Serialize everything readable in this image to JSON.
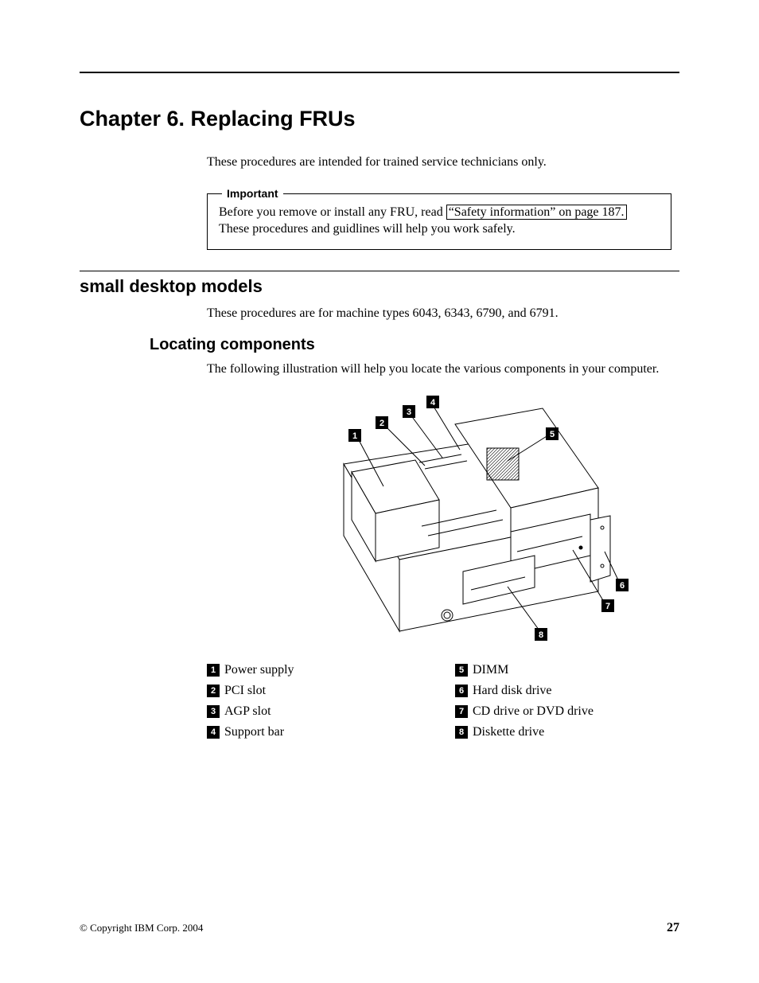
{
  "chapter_title": "Chapter 6. Replacing FRUs",
  "intro_para": "These procedures are intended for trained service technicians only.",
  "notice": {
    "legend": "Important",
    "text_before_ref": "Before you remove or install any FRU, read ",
    "xref": "“Safety information” on page 187.",
    "text_after_ref": " These procedures and guidlines will help you work safely."
  },
  "section1": {
    "title": "small desktop models",
    "para": "These procedures are for machine types 6043, 6343, 6790, and 6791."
  },
  "subsection1": {
    "title": "Locating components",
    "para": "The following illustration will help you locate the various components in your computer."
  },
  "callouts": [
    "1",
    "2",
    "3",
    "4",
    "5",
    "6",
    "7",
    "8"
  ],
  "legend_left": [
    {
      "n": "1",
      "label": "Power supply"
    },
    {
      "n": "2",
      "label": "PCI slot"
    },
    {
      "n": "3",
      "label": "AGP slot"
    },
    {
      "n": "4",
      "label": "Support bar"
    }
  ],
  "legend_right": [
    {
      "n": "5",
      "label": "DIMM"
    },
    {
      "n": "6",
      "label": "Hard disk drive"
    },
    {
      "n": "7",
      "label": "CD drive or DVD drive"
    },
    {
      "n": "8",
      "label": "Diskette drive"
    }
  ],
  "footer": {
    "copyright": "© Copyright IBM Corp. 2004",
    "page": "27"
  }
}
